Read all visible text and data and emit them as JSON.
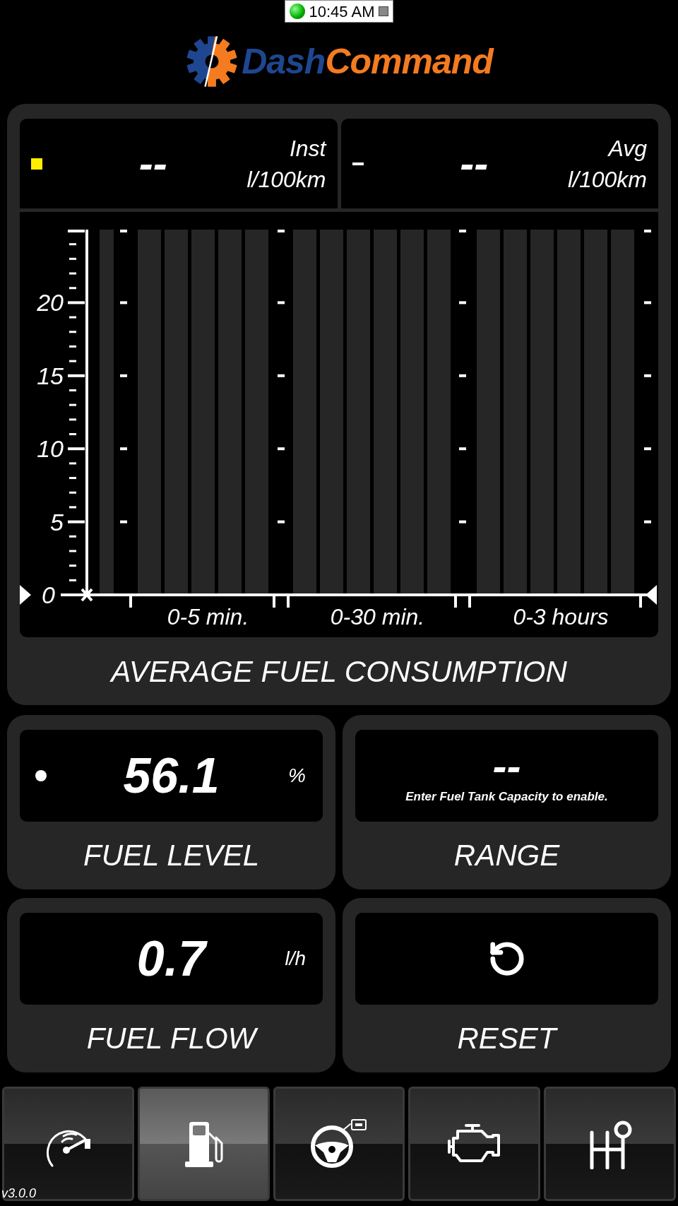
{
  "status_bar": {
    "time": "10:45 AM"
  },
  "logo": {
    "parts": [
      {
        "text": "Dash",
        "color": "#1f4690"
      },
      {
        "text": "Command",
        "color": "#f47b20"
      }
    ]
  },
  "readouts": [
    {
      "kind": "square",
      "value": "--",
      "name": "Inst",
      "unit": "l/100km"
    },
    {
      "kind": "dash",
      "value": "--",
      "name": "Avg",
      "unit": "l/100km"
    }
  ],
  "consumption": {
    "title": "AVERAGE FUEL CONSUMPTION",
    "chart_data": {
      "type": "bar",
      "categories": [
        "0-5 min.",
        "0-30 min.",
        "0-3 hours"
      ],
      "values": [
        null,
        null,
        null
      ],
      "ylim": [
        0,
        25
      ],
      "yticks": [
        0,
        5,
        10,
        15,
        20
      ]
    }
  },
  "tiles": [
    {
      "kind": "reading",
      "marker": true,
      "value": "56.1",
      "unit": "%",
      "label": "FUEL LEVEL"
    },
    {
      "kind": "message",
      "value": "--",
      "note": "Enter Fuel Tank Capacity to enable.",
      "label": "RANGE"
    },
    {
      "kind": "reading",
      "marker": false,
      "value": "0.7",
      "unit": "l/h",
      "label": "FUEL FLOW"
    },
    {
      "kind": "action",
      "label": "RESET"
    }
  ],
  "nav": [
    {
      "kind": "gauge",
      "selected": false
    },
    {
      "kind": "fuel",
      "selected": true
    },
    {
      "kind": "steering",
      "selected": false
    },
    {
      "kind": "engine",
      "selected": false
    },
    {
      "kind": "shifter",
      "selected": false
    }
  ],
  "version": "v3.0.0"
}
